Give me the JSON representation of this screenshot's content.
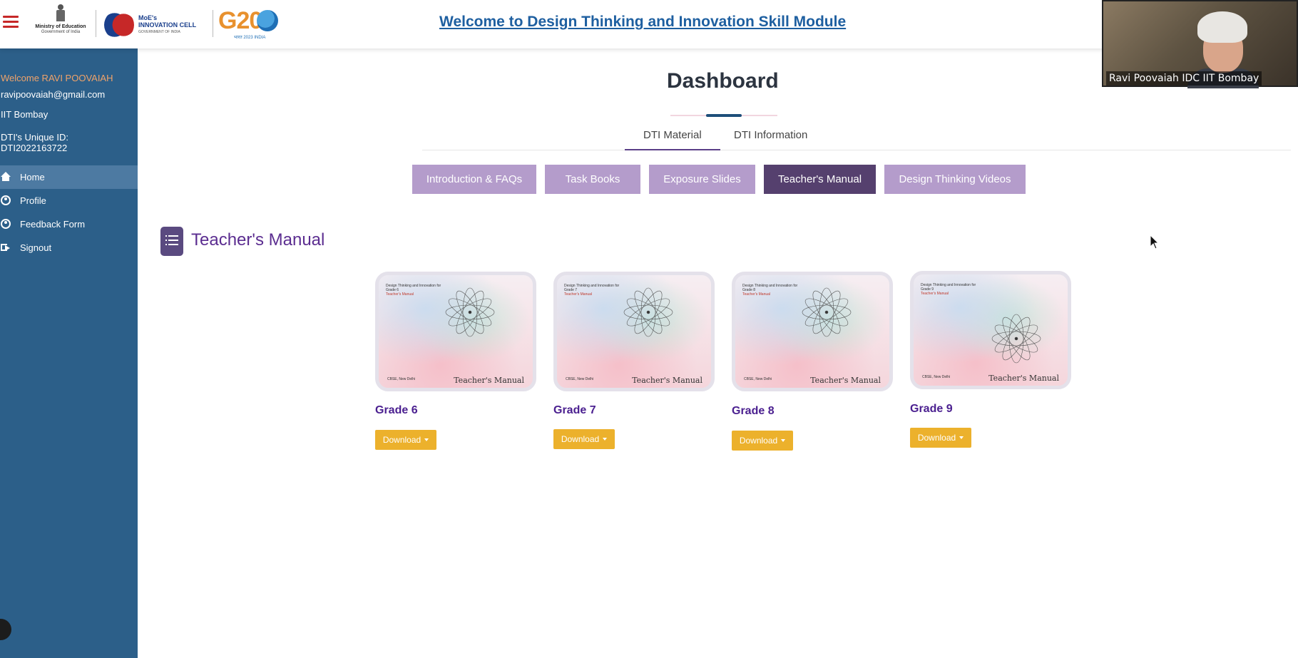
{
  "header": {
    "moe_line1": "Ministry of Education",
    "moe_line2": "Government of India",
    "mic_line1": "MoE's",
    "mic_line2": "INNOVATION CELL",
    "mic_line3": "GOVERNMENT OF INDIA",
    "g20_text": "G20",
    "g20_sub": "भारत 2023 INDIA",
    "title": "Welcome to Design Thinking and Innovation Skill Module"
  },
  "video": {
    "participant_name": "Ravi Poovaiah IDC IIT Bombay"
  },
  "sidebar": {
    "welcome": "Welcome RAVI POOVAIAH",
    "email": "ravipoovaiah@gmail.com",
    "org": "IIT Bombay",
    "uid_label": "DTI's Unique ID:",
    "uid_value": "DTI2022163722",
    "nav": [
      {
        "label": "Home",
        "icon": "home-icon",
        "active": true
      },
      {
        "label": "Profile",
        "icon": "user-icon",
        "active": false
      },
      {
        "label": "Feedback Form",
        "icon": "user-icon",
        "active": false
      },
      {
        "label": "Signout",
        "icon": "signout-icon",
        "active": false
      }
    ]
  },
  "main": {
    "dashboard_title": "Dashboard",
    "tabs": [
      {
        "label": "DTI Material",
        "active": true
      },
      {
        "label": "DTI Information",
        "active": false
      }
    ],
    "categories": [
      {
        "label": "Introduction & FAQs",
        "active": false
      },
      {
        "label": "Task Books",
        "active": false
      },
      {
        "label": "Exposure Slides",
        "active": false
      },
      {
        "label": "Teacher's Manual",
        "active": true
      },
      {
        "label": "Design Thinking Videos",
        "active": false
      }
    ],
    "section_title": "Teacher's Manual",
    "cards": [
      {
        "grade": "Grade 6",
        "cover_label": "Teacher's Manual",
        "cover_title": "Design Thinking and Innovation for Grade 6",
        "cover_sub": "Teacher's Manual",
        "cover_org": "CBSE, New Delhi",
        "button": "Download"
      },
      {
        "grade": "Grade 7",
        "cover_label": "Teacher's Manual",
        "cover_title": "Design Thinking and Innovation for Grade 7",
        "cover_sub": "Teacher's Manual",
        "cover_org": "CBSE, New Delhi",
        "button": "Download"
      },
      {
        "grade": "Grade 8",
        "cover_label": "Teacher's Manual",
        "cover_title": "Design Thinking and Innovation for Grade 8",
        "cover_sub": "Teacher's Manual",
        "cover_org": "CBSE, New Delhi",
        "button": "Download"
      },
      {
        "grade": "Grade 9",
        "cover_label": "Teacher's Manual",
        "cover_title": "Design Thinking and Innovation for Grade 9",
        "cover_sub": "Teacher's Manual",
        "cover_org": "CBSE, New Delhi",
        "button": "Download"
      }
    ]
  },
  "colors": {
    "sidebar_bg": "#2c5f89",
    "accent_purple": "#55406e",
    "button_purple": "#b49ccb",
    "download_yellow": "#ecb12c",
    "title_blue": "#1e5fa0"
  }
}
